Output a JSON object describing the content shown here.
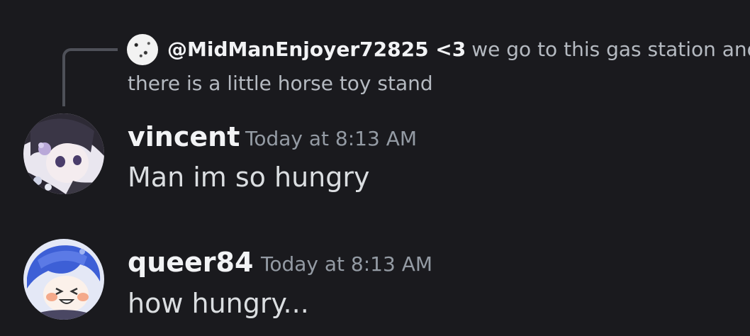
{
  "reply": {
    "author": "@MidManEnjoyer72825 <3",
    "text_line1": "we go to this gas station and",
    "text_line2": "there is a little horse toy stand"
  },
  "messages": [
    {
      "username": "vincent",
      "timestamp": "Today at 8:13 AM",
      "content": "Man im so hungry"
    },
    {
      "username": "queer84",
      "timestamp": "Today at 8:13 AM",
      "content": "how hungry..."
    }
  ],
  "colors": {
    "background": "#1a1a1e",
    "username": "#f2f3f5",
    "message_text": "#dbdee1",
    "timestamp": "#949ba4",
    "reply_text": "#b5bac1",
    "reply_spine": "#4e5058"
  }
}
